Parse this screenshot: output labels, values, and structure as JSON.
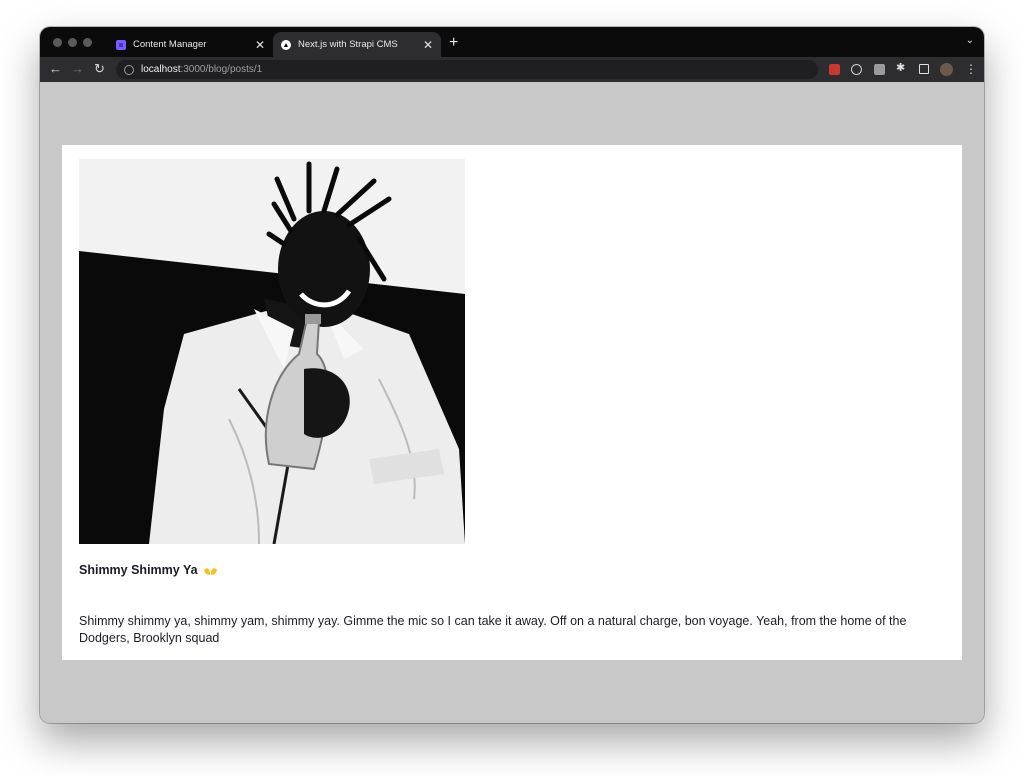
{
  "browser": {
    "tabs": [
      {
        "title": "Content Manager",
        "active": false,
        "favicon": "strapi-icon"
      },
      {
        "title": "Next.js with Strapi CMS",
        "active": true,
        "favicon": "nextjs-icon"
      }
    ],
    "new_tab": "+",
    "url_host": "localhost",
    "url_path": ":3000/blog/posts/1",
    "extension_icons": [
      "extension-red-icon",
      "extension-circle-icon",
      "extension-square-icon",
      "puzzle-icon",
      "sidepanel-icon",
      "profile-avatar"
    ]
  },
  "post": {
    "image_description": "black and white photo",
    "title": "Shimmy Shimmy Ya",
    "title_emoji": "🙌",
    "body": "Shimmy shimmy ya, shimmy yam, shimmy yay. Gimme the mic so I can take it away. Off on a natural charge, bon voyage. Yeah, from the home of the Dodgers, Brooklyn squad"
  },
  "colors": {
    "page_background": "#c8c8c8",
    "card_background": "#ffffff",
    "text": "#1c1c28"
  }
}
